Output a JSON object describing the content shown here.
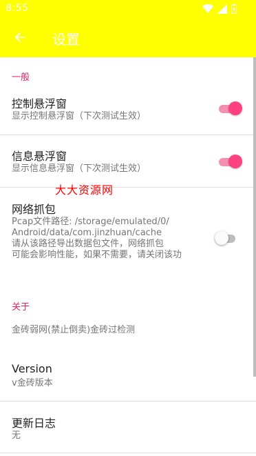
{
  "status_bar": {
    "time": "8:55",
    "icons": [
      "wifi-icon",
      "signal-icon",
      "battery-icon"
    ]
  },
  "app_bar": {
    "title": "设置",
    "back_icon": "arrow-back-icon"
  },
  "colors": {
    "app_bar": "#ffff00",
    "accent": "#e91e63",
    "switch_on": "#ff4081"
  },
  "sections": {
    "general": {
      "header": "一般",
      "items": [
        {
          "title": "控制悬浮窗",
          "summary": "显示控制悬浮窗（下次测试生效）",
          "switch": true
        },
        {
          "title": "信息悬浮窗",
          "summary": "显示信息悬浮窗（下次测试生效）",
          "switch": true
        },
        {
          "title": "网络抓包",
          "summary_lines": [
            "Pcap文件路径: /storage/emulated/0/",
            "Android/data/com.jinzhuan/cache",
            "请从该路径导出数据包文件，网络抓包",
            "可能会影响性能，如果不需要，请关闭该功"
          ],
          "switch": false
        }
      ]
    },
    "about": {
      "header": "关于",
      "items": [
        {
          "text": "金砖弱网(禁止倒卖)金砖过检测"
        },
        {
          "title": "Version",
          "summary": "v金砖版本"
        },
        {
          "title": "更新日志",
          "summary": "无"
        }
      ]
    }
  },
  "watermark": "大大资源网"
}
